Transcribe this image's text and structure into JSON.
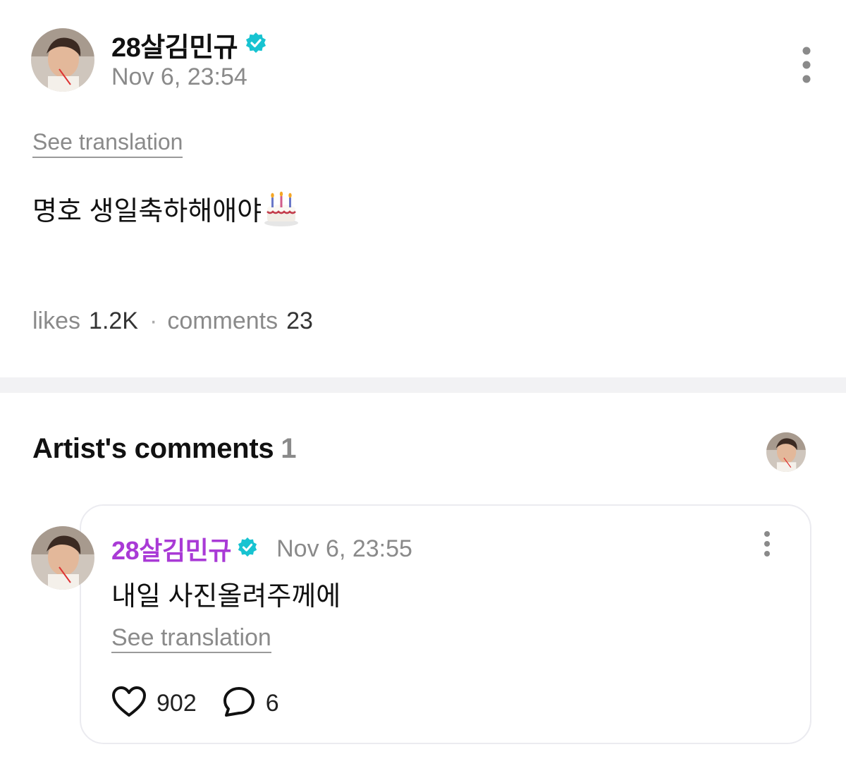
{
  "post": {
    "author": "28살김민규",
    "verified": true,
    "timestamp": "Nov 6, 23:54",
    "see_translation": "See translation",
    "body_text": "명호 생일축하해애야",
    "body_emoji": "birthday-cake-icon",
    "stats": {
      "likes_label": "likes",
      "likes_count": "1.2K",
      "separator": "·",
      "comments_label": "comments",
      "comments_count": "23"
    }
  },
  "artist_comments": {
    "heading": "Artist's comments",
    "count": "1",
    "items": [
      {
        "author": "28살김민규",
        "verified": true,
        "timestamp": "Nov 6, 23:55",
        "body": "내일 사진올려주께에",
        "see_translation": "See translation",
        "likes": "902",
        "replies": "6"
      }
    ]
  },
  "colors": {
    "verified_badge": "#17c3d1",
    "artist_name": "#a93ad6",
    "secondary_text": "#8a8a8a",
    "divider": "#f2f2f4",
    "card_border": "#ebebf0"
  }
}
